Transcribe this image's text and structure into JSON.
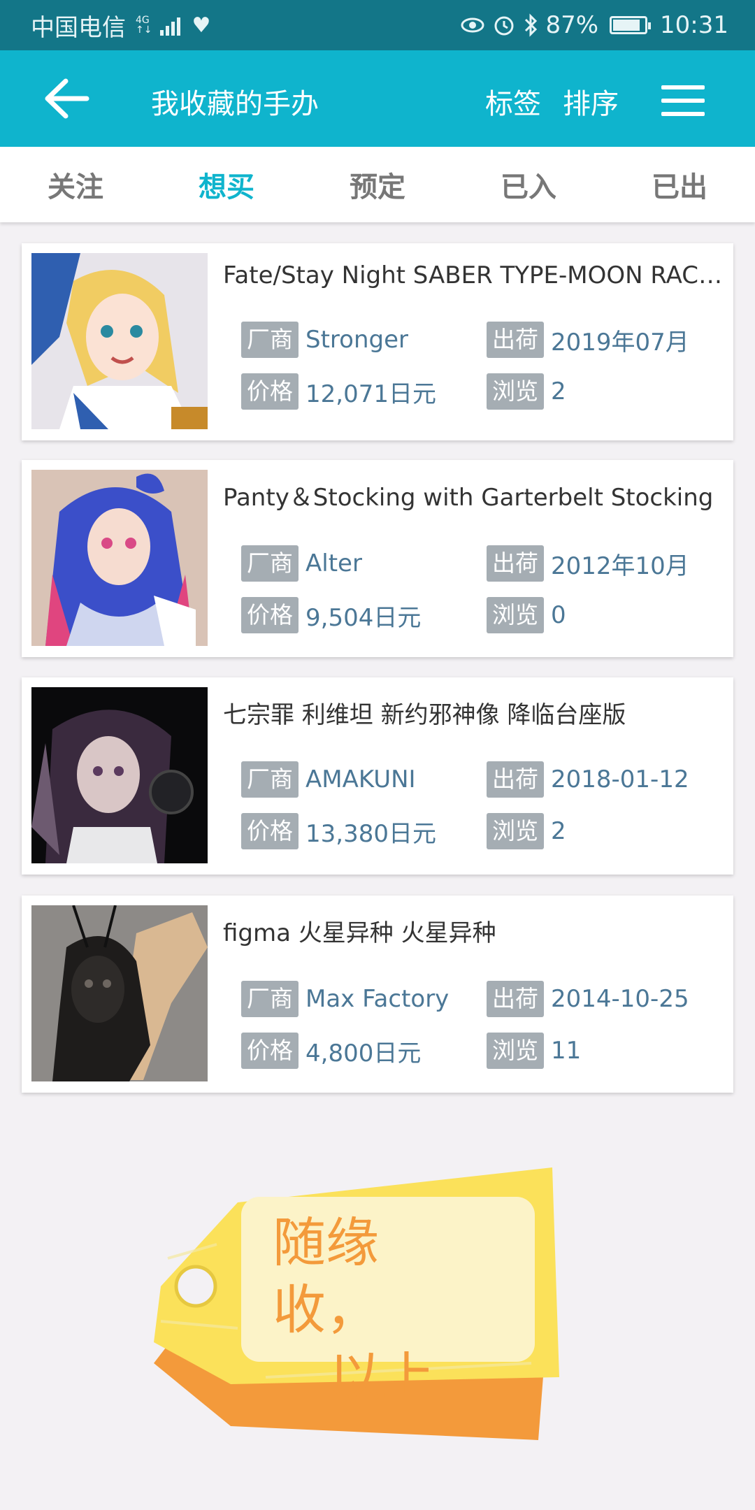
{
  "status_bar": {
    "carrier": "中国电信",
    "network": "4G",
    "battery_percent": "87%",
    "battery_level": 0.87,
    "time": "10:31"
  },
  "app_bar": {
    "title": "我收藏的手办",
    "tags_label": "标签",
    "sort_label": "排序",
    "back_icon": "arrow-left-icon",
    "menu_icon": "hamburger-menu-icon"
  },
  "tabs": [
    {
      "label": "关注",
      "active": false
    },
    {
      "label": "想买",
      "active": true
    },
    {
      "label": "预定",
      "active": false
    },
    {
      "label": "已入",
      "active": false
    },
    {
      "label": "已出",
      "active": false
    }
  ],
  "field_labels": {
    "maker": "厂商",
    "release": "出荷",
    "price": "价格",
    "views": "浏览"
  },
  "items": [
    {
      "title": "Fate/Stay Night SABER TYPE-MOON RACI...",
      "maker": "Stronger",
      "release": "2019年07月",
      "price": "12,071日元",
      "views": "2"
    },
    {
      "title": "Panty＆Stocking with Garterbelt Stocking",
      "maker": "Alter",
      "release": "2012年10月",
      "price": "9,504日元",
      "views": "0"
    },
    {
      "title": "七宗罪 利维坦 新约邪神像 降临台座版",
      "maker": "AMAKUNI",
      "release": "2018-01-12",
      "price": "13,380日元",
      "views": "2"
    },
    {
      "title": "figma 火星异种 火星异种",
      "maker": "Max Factory",
      "release": "2014-10-25",
      "price": "4,800日元",
      "views": "11"
    }
  ],
  "footer_tag": {
    "line1": "随缘收，",
    "line2": "以上"
  },
  "colors": {
    "status_bar": "#137688",
    "app_bar": "#0fb4cd",
    "active_tab": "#0fb4cd",
    "badge": "#a5adb3",
    "value_text": "#4b7796",
    "tag_yellow": "#fbe15a",
    "tag_orange": "#f39a3b"
  }
}
